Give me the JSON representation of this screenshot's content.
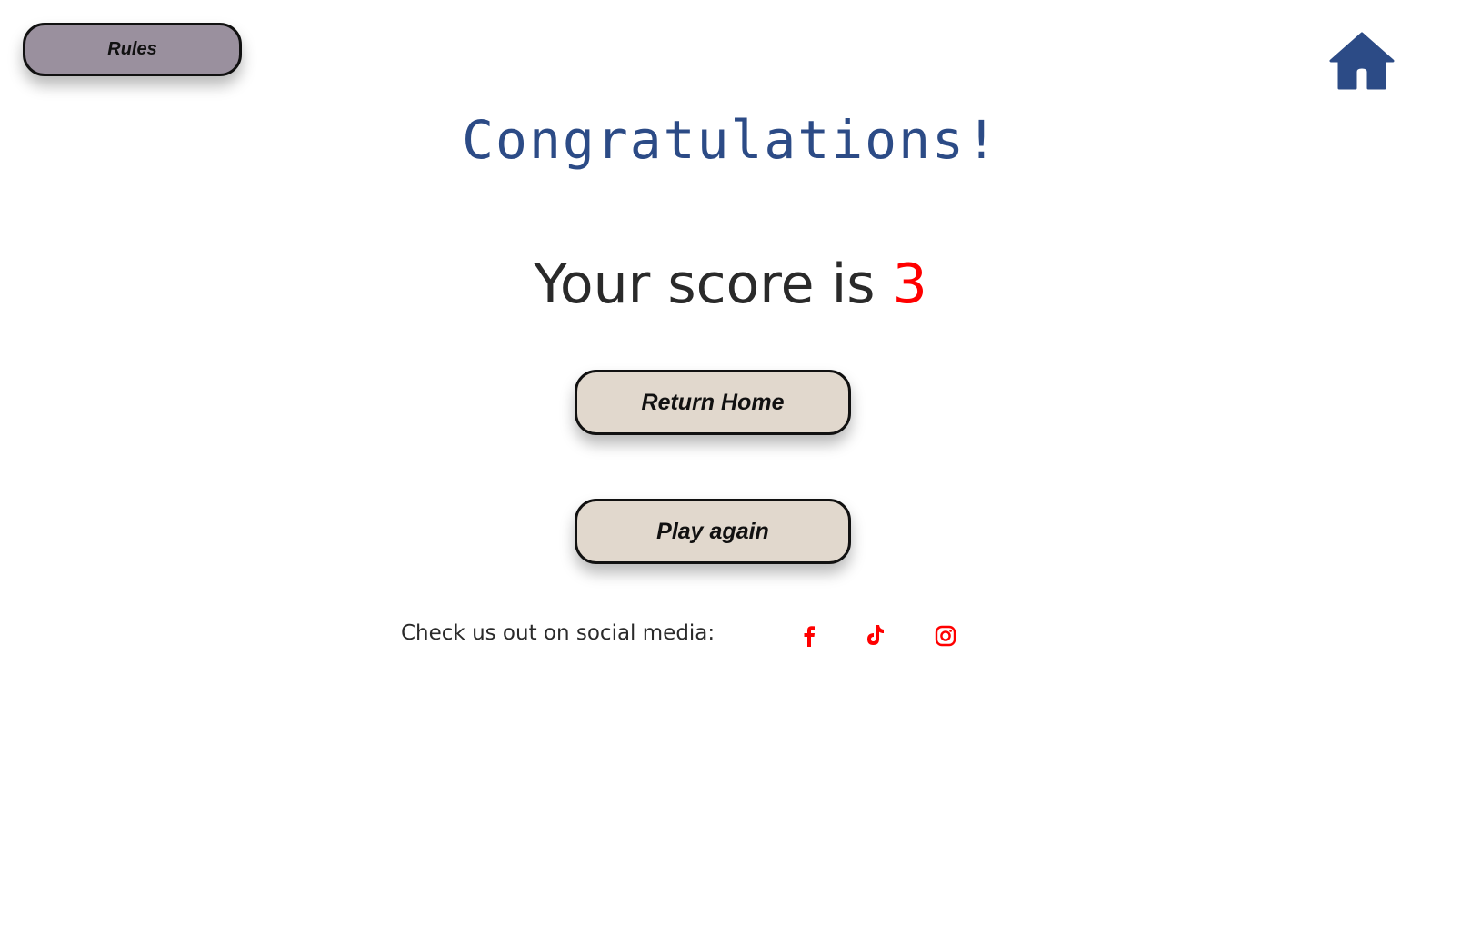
{
  "header": {
    "rules_label": "Rules",
    "home_icon": "home-icon"
  },
  "main": {
    "title": "Congratulations!",
    "score_prefix": "Your score is",
    "score_value": "3"
  },
  "actions": {
    "return_home_label": "Return Home",
    "play_again_label": "Play again"
  },
  "social": {
    "label": "Check us out on social media:",
    "icons": [
      "facebook-icon",
      "tiktok-icon",
      "instagram-icon"
    ]
  },
  "colors": {
    "title": "#2c4b86",
    "home_icon": "#2c4b86",
    "score_value": "#ff0000",
    "social_icons": "#ff0000",
    "rules_button_bg": "#9a909e",
    "action_button_bg": "#e1d8cd"
  }
}
